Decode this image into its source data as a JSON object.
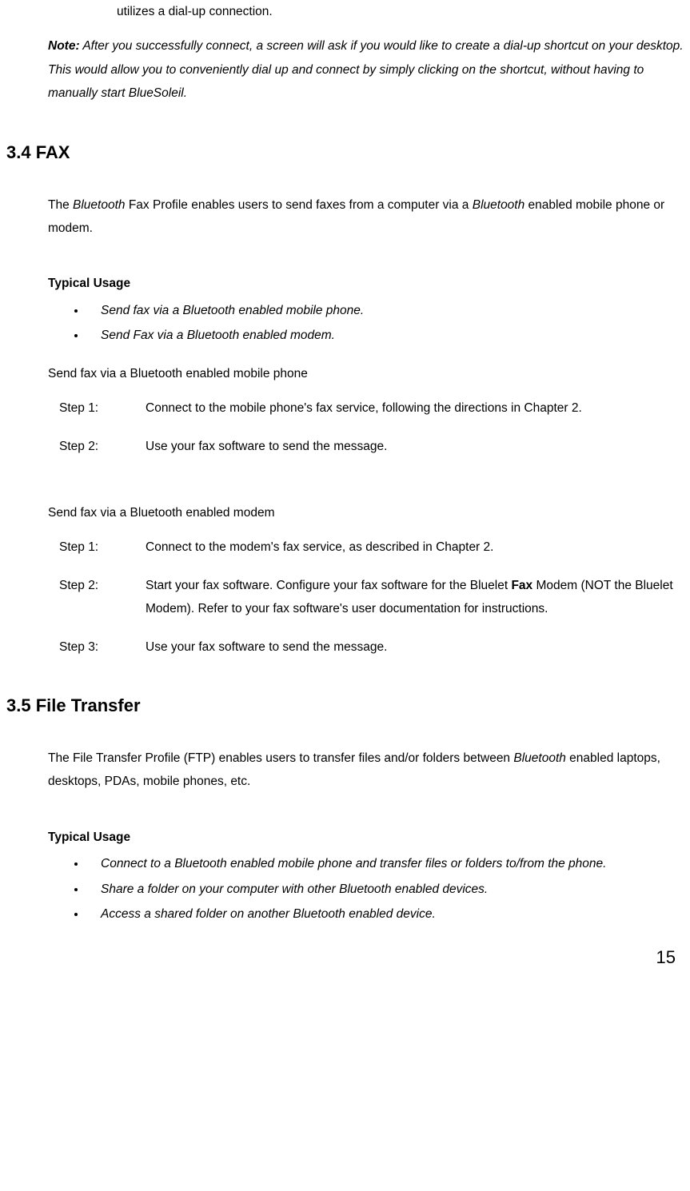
{
  "continuation": "utilizes a dial-up connection.",
  "note_label": "Note:",
  "note_text": " After you successfully connect, a screen will ask if you would like to create a dial-up shortcut on your desktop. This would allow you to conveniently dial up and connect by simply clicking on the shortcut, without having to manually start BlueSoleil.",
  "fax": {
    "heading": "3.4 FAX",
    "intro_1": "The ",
    "intro_em1": "Bluetooth",
    "intro_2": " Fax Profile enables users to send faxes from a computer via a ",
    "intro_em2": "Bluetooth",
    "intro_3": " enabled mobile phone or modem.",
    "typical_usage_label": "Typical Usage",
    "usage_items": [
      "Send fax via a Bluetooth enabled mobile phone.",
      "Send Fax via a Bluetooth enabled modem."
    ],
    "phone_title": "Send fax via a Bluetooth enabled mobile phone",
    "phone_steps": [
      {
        "label": "Step 1:",
        "text": "Connect to the mobile phone's fax service, following the directions in Chapter 2."
      },
      {
        "label": "Step 2:",
        "text": "Use your fax software to send the message."
      }
    ],
    "modem_title": "Send fax via a Bluetooth enabled modem",
    "modem_step1_label": "Step 1:",
    "modem_step1_text": "Connect to the modem's fax service, as described in Chapter 2.",
    "modem_step2_label": "Step 2:",
    "modem_step2_a": "Start your fax software. Configure your fax software for the Bluelet ",
    "modem_step2_bold": "Fax",
    "modem_step2_b": " Modem (NOT the Bluelet Modem). Refer to your fax software's user documentation for instructions.",
    "modem_step3_label": "Step 3:",
    "modem_step3_text": "Use your fax software to send the message."
  },
  "ft": {
    "heading": "3.5 File Transfer",
    "intro_a": "The File Transfer Profile (FTP) enables users to transfer files and/or folders between ",
    "intro_em": "Bluetooth",
    "intro_b": " enabled laptops, desktops, PDAs, mobile phones, etc.",
    "typical_usage_label": "Typical Usage",
    "usage_items": [
      "Connect to a Bluetooth enabled mobile phone and transfer files or folders to/from the phone.",
      "Share a folder on your computer with other Bluetooth enabled devices.",
      "Access a shared folder on another Bluetooth enabled device."
    ]
  },
  "page_number": "15"
}
